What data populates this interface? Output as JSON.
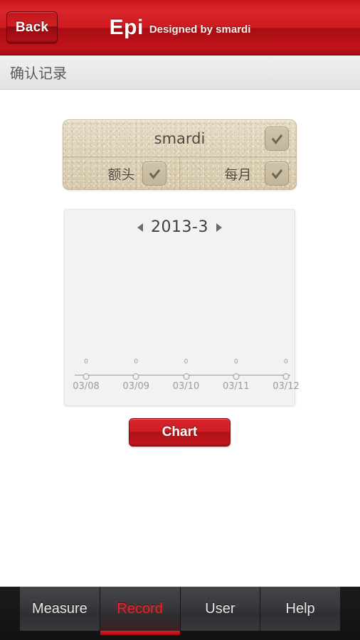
{
  "header": {
    "back_label": "Back",
    "app_title": "Epi",
    "app_subtitle": "Designed by smardi",
    "accent_color": "#c9161c"
  },
  "subheader": {
    "title": "确认记录"
  },
  "selector": {
    "user": {
      "value": "smardi",
      "chevron": "chevron-down-icon"
    },
    "site": {
      "value": "额头",
      "chevron": "chevron-down-icon"
    },
    "period": {
      "value": "每月",
      "chevron": "chevron-down-icon"
    }
  },
  "chart_panel": {
    "prev_arrow": "triangle-left-icon",
    "next_arrow": "triangle-right-icon",
    "month_label": "2013-3"
  },
  "chart_data": {
    "type": "line",
    "title": "2013-3",
    "xlabel": "",
    "ylabel": "",
    "categories": [
      "03/08",
      "03/09",
      "03/10",
      "03/11",
      "03/12"
    ],
    "values": [
      0,
      0,
      0,
      0,
      0
    ],
    "point_labels": [
      "0",
      "0",
      "0",
      "0",
      "0"
    ],
    "ylim": [
      0,
      0
    ],
    "grid": false,
    "legend": "none",
    "axis_color": "#9a9a9a",
    "label_color": "#9b9b9b"
  },
  "actions": {
    "chart_button": "Chart"
  },
  "tabbar": {
    "tabs": [
      {
        "label": "Measure",
        "active": false
      },
      {
        "label": "Record",
        "active": true
      },
      {
        "label": "User",
        "active": false
      },
      {
        "label": "Help",
        "active": false
      }
    ],
    "active_color": "#e8272d"
  }
}
